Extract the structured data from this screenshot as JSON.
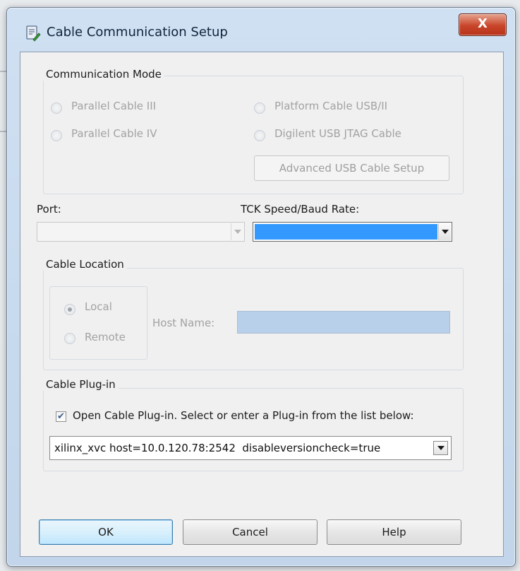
{
  "window": {
    "title": "Cable Communication Setup",
    "close_glyph": "X",
    "icon": "cable-setup-icon"
  },
  "communication_mode": {
    "label": "Communication Mode",
    "options": [
      {
        "label": "Parallel Cable III",
        "selected": false,
        "enabled": false
      },
      {
        "label": "Parallel Cable IV",
        "selected": false,
        "enabled": false
      },
      {
        "label": "Platform Cable USB/II",
        "selected": false,
        "enabled": false
      },
      {
        "label": "Digilent USB JTAG Cable",
        "selected": false,
        "enabled": false
      }
    ],
    "advanced_button": "Advanced USB Cable Setup"
  },
  "port": {
    "label": "Port:",
    "value": ""
  },
  "tck_speed": {
    "label": "TCK Speed/Baud Rate:",
    "value": "",
    "highlight_color": "#3399ff"
  },
  "cable_location": {
    "label": "Cable Location",
    "local_label": "Local",
    "local_selected": true,
    "remote_label": "Remote",
    "remote_selected": false,
    "host_label": "Host Name:",
    "host_value": ""
  },
  "cable_plugin": {
    "label": "Cable Plug-in",
    "checkbox_label": "Open Cable Plug-in. Select or enter a Plug-in from the list below:",
    "checked": true,
    "plugin_value": "xilinx_xvc host=10.0.120.78:2542  disableversioncheck=true"
  },
  "buttons": {
    "ok": "OK",
    "cancel": "Cancel",
    "help": "Help"
  }
}
